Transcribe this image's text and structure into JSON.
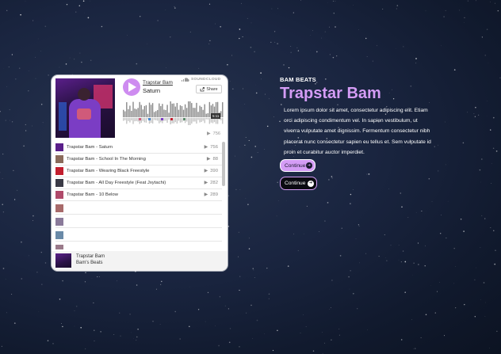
{
  "player": {
    "artist": "Trapstar Bam",
    "title": "Saturn",
    "brand": "SOUNDCLOUD",
    "share_label": "Share",
    "duration": "5:11",
    "plays_total": "756",
    "tracks": [
      {
        "name": "Trapstar Bam - Saturn",
        "count": "756",
        "color": "#5a1f8a"
      },
      {
        "name": "Trapstar Bam - School In The Morning",
        "count": "88",
        "color": "#8a6a5a"
      },
      {
        "name": "Trapstar Bam - Wearing Black Freestyle",
        "count": "390",
        "color": "#c21e2e"
      },
      {
        "name": "Trapstar Bam - All Day Freestyle (Feat Jxytachi)",
        "count": "282",
        "color": "#3a3a46"
      },
      {
        "name": "Trapstar Bam - 10 Below",
        "count": "289",
        "color": "#b04a6a"
      }
    ],
    "placeholder_thumbs": [
      "#a86a6a",
      "#8a7a9a",
      "#6a8aa8",
      "#9a7a8a"
    ],
    "footer": {
      "artist": "Trapstar Bam",
      "playlist": "Bam's Beats"
    }
  },
  "content": {
    "eyebrow": "BAM BEATS",
    "headline": "Trapstar Bam",
    "lines": [
      "Lorem ipsum dolor sit amet, consectetur adipiscing elit. Etiam",
      "orci adipiscing condimentum vel. In sapien vestibulum, ut",
      "viverra vulputate amet dignissim. Fermentum consectetur nibh",
      "placerat nunc consectetur sapien eu tellus et. Sem vulputate id",
      "proin et curabitur auctor imperdiet."
    ],
    "btn_primary": "Continue",
    "btn_secondary": "Continue"
  },
  "colors": {
    "accent": "#d49cf5",
    "play": "#ce8cf0"
  }
}
